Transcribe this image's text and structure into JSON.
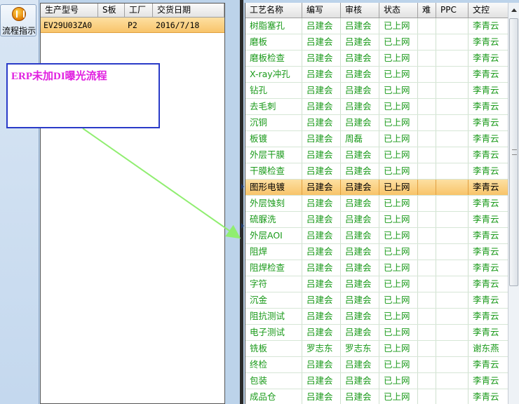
{
  "toolbar": {
    "flow_button_label": "流程指示"
  },
  "left_grid": {
    "columns": [
      "生产型号",
      "S板",
      "工厂",
      "交货日期"
    ],
    "row": {
      "model": "EV29U03ZA0",
      "s_board": "",
      "factory": "P2",
      "delivery_date": "2016/7/18"
    }
  },
  "right_grid": {
    "columns": [
      "工艺名称",
      "编写",
      "审核",
      "状态",
      "难",
      "PPC",
      "文控"
    ],
    "selected_index": 10,
    "rows": [
      {
        "name": "树脂塞孔",
        "author": "吕建会",
        "reviewer": "吕建会",
        "status": "已上网",
        "difficulty": "",
        "ppc": "",
        "doc_control": "李青云"
      },
      {
        "name": "磨板",
        "author": "吕建会",
        "reviewer": "吕建会",
        "status": "已上网",
        "difficulty": "",
        "ppc": "",
        "doc_control": "李青云"
      },
      {
        "name": "磨板检查",
        "author": "吕建会",
        "reviewer": "吕建会",
        "status": "已上网",
        "difficulty": "",
        "ppc": "",
        "doc_control": "李青云"
      },
      {
        "name": "X-ray冲孔",
        "author": "吕建会",
        "reviewer": "吕建会",
        "status": "已上网",
        "difficulty": "",
        "ppc": "",
        "doc_control": "李青云"
      },
      {
        "name": "钻孔",
        "author": "吕建会",
        "reviewer": "吕建会",
        "status": "已上网",
        "difficulty": "",
        "ppc": "",
        "doc_control": "李青云"
      },
      {
        "name": "去毛刺",
        "author": "吕建会",
        "reviewer": "吕建会",
        "status": "已上网",
        "difficulty": "",
        "ppc": "",
        "doc_control": "李青云"
      },
      {
        "name": "沉铜",
        "author": "吕建会",
        "reviewer": "吕建会",
        "status": "已上网",
        "difficulty": "",
        "ppc": "",
        "doc_control": "李青云"
      },
      {
        "name": "板镀",
        "author": "吕建会",
        "reviewer": "周磊",
        "status": "已上网",
        "difficulty": "",
        "ppc": "",
        "doc_control": "李青云"
      },
      {
        "name": "外层干膜",
        "author": "吕建会",
        "reviewer": "吕建会",
        "status": "已上网",
        "difficulty": "",
        "ppc": "",
        "doc_control": "李青云"
      },
      {
        "name": "干膜检查",
        "author": "吕建会",
        "reviewer": "吕建会",
        "status": "已上网",
        "difficulty": "",
        "ppc": "",
        "doc_control": "李青云"
      },
      {
        "name": "图形电镀",
        "author": "吕建会",
        "reviewer": "吕建会",
        "status": "已上网",
        "difficulty": "",
        "ppc": "",
        "doc_control": "李青云"
      },
      {
        "name": "外层蚀刻",
        "author": "吕建会",
        "reviewer": "吕建会",
        "status": "已上网",
        "difficulty": "",
        "ppc": "",
        "doc_control": "李青云"
      },
      {
        "name": "硫脲洗",
        "author": "吕建会",
        "reviewer": "吕建会",
        "status": "已上网",
        "difficulty": "",
        "ppc": "",
        "doc_control": "李青云"
      },
      {
        "name": "外层AOI",
        "author": "吕建会",
        "reviewer": "吕建会",
        "status": "已上网",
        "difficulty": "",
        "ppc": "",
        "doc_control": "李青云"
      },
      {
        "name": "阻焊",
        "author": "吕建会",
        "reviewer": "吕建会",
        "status": "已上网",
        "difficulty": "",
        "ppc": "",
        "doc_control": "李青云"
      },
      {
        "name": "阻焊检查",
        "author": "吕建会",
        "reviewer": "吕建会",
        "status": "已上网",
        "difficulty": "",
        "ppc": "",
        "doc_control": "李青云"
      },
      {
        "name": "字符",
        "author": "吕建会",
        "reviewer": "吕建会",
        "status": "已上网",
        "difficulty": "",
        "ppc": "",
        "doc_control": "李青云"
      },
      {
        "name": "沉金",
        "author": "吕建会",
        "reviewer": "吕建会",
        "status": "已上网",
        "difficulty": "",
        "ppc": "",
        "doc_control": "李青云"
      },
      {
        "name": "阻抗测试",
        "author": "吕建会",
        "reviewer": "吕建会",
        "status": "已上网",
        "difficulty": "",
        "ppc": "",
        "doc_control": "李青云"
      },
      {
        "name": "电子测试",
        "author": "吕建会",
        "reviewer": "吕建会",
        "status": "已上网",
        "difficulty": "",
        "ppc": "",
        "doc_control": "李青云"
      },
      {
        "name": "铣板",
        "author": "罗志东",
        "reviewer": "罗志东",
        "status": "已上网",
        "difficulty": "",
        "ppc": "",
        "doc_control": "谢东燕"
      },
      {
        "name": "终检",
        "author": "吕建会",
        "reviewer": "吕建会",
        "status": "已上网",
        "difficulty": "",
        "ppc": "",
        "doc_control": "李青云"
      },
      {
        "name": "包装",
        "author": "吕建会",
        "reviewer": "吕建会",
        "status": "已上网",
        "difficulty": "",
        "ppc": "",
        "doc_control": "李青云"
      },
      {
        "name": "成品仓",
        "author": "吕建会",
        "reviewer": "吕建会",
        "status": "已上网",
        "difficulty": "",
        "ppc": "",
        "doc_control": "李青云"
      }
    ]
  },
  "annotation": {
    "text": "ERP未加DI曝光流程",
    "border_color": "#2a3bc8",
    "text_color": "#e020e0",
    "arrow_color": "#90ee70"
  },
  "colors": {
    "row_text": "#1a9a1a",
    "selection": "#f8c46a",
    "background": "#bcd3ea"
  },
  "icons": {
    "flow_button": "pause-circle-icon"
  }
}
